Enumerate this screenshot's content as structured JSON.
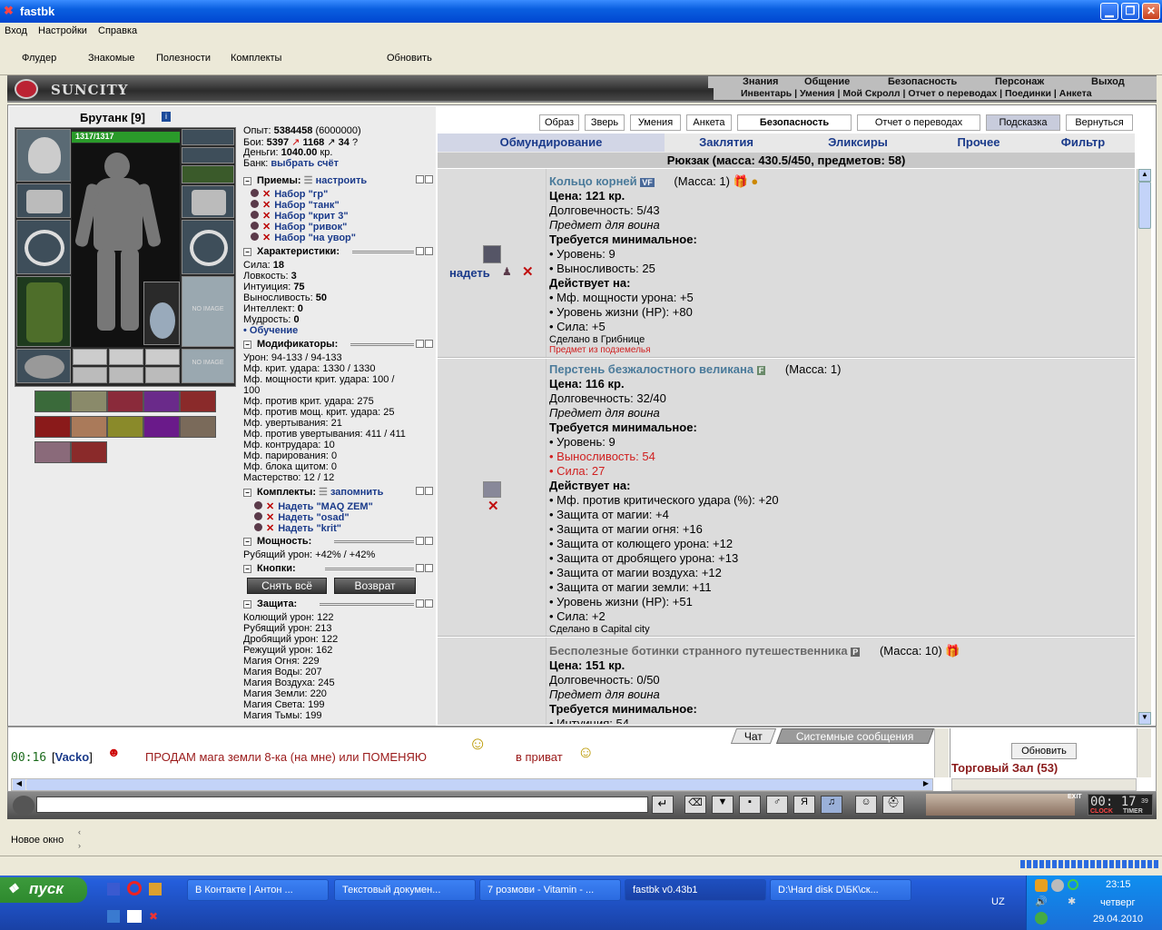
{
  "window": {
    "title": "fastbk",
    "btn_min": "▁",
    "btn_max": "❐",
    "btn_close": "✕"
  },
  "menu": [
    "Вход",
    "Настройки",
    "Справка"
  ],
  "toolbar": [
    "Флудер",
    "Знакомые",
    "Полезности",
    "Комплекты",
    "Обновить"
  ],
  "logo": "SUNCITY",
  "topnav1": [
    "Знания",
    "Общение",
    "Безопасность",
    "Персонаж",
    "Выход"
  ],
  "topnav2": "Инвентарь | Умения | Мой Скролл | Отчет о переводах | Поединки | Анкета",
  "character": {
    "name": "Брутанк [9]",
    "hp": "1317/1317",
    "empty_slot": "NO IMAGE"
  },
  "stats": {
    "exp_label": "Опыт:",
    "exp_value": "5384458",
    "exp_next": "(6000000)",
    "fights_label": "Бои:",
    "fights_win": "5397",
    "fights_lose": "1168",
    "fights_draw": "34",
    "money_label": "Деньги:",
    "money_value": "1040.00",
    "money_unit": "кр.",
    "bank_label": "Банк:",
    "bank_link": "выбрать счёт"
  },
  "priemy": {
    "title": "Приемы:",
    "link": "настроить",
    "sets": [
      "Набор \"гр\"",
      "Набор \"танк\"",
      "Набор \"крит 3\"",
      "Набор \"ривок\"",
      "Набор \"на увор\""
    ]
  },
  "chars": {
    "title": "Характеристики:",
    "rows": [
      [
        "Сила:",
        "18"
      ],
      [
        "Ловкость:",
        "3"
      ],
      [
        "Интуиция:",
        "75"
      ],
      [
        "Выносливость:",
        "50"
      ],
      [
        "Интеллект:",
        "0"
      ],
      [
        "Мудрость:",
        "0"
      ]
    ],
    "learn": "• Обучение"
  },
  "mods": {
    "title": "Модификаторы:",
    "rows": [
      "Урон: 94-133 / 94-133",
      "Мф. крит. удара: 1330 / 1330",
      "Мф. мощности крит. удара: 100 /",
      "100",
      "Мф. против крит. удара: 275",
      "Мф. против мощ. крит. удара: 25",
      "Мф. увертывания: 21",
      "Мф. против увертывания: 411 / 411",
      "Мф. контрудара: 10",
      "Мф. парирования: 0",
      "Мф. блока щитом: 0",
      "Мастерство: 12 / 12"
    ]
  },
  "komplekty": {
    "title": "Комплекты:",
    "link": "запомнить",
    "sets": [
      "Надеть \"MAQ ZEM\"",
      "Надеть \"osad\"",
      "Надеть \"krit\""
    ]
  },
  "moshnosti": {
    "title": "Мощность:",
    "row": "Рубящий урон: +42% / +42%"
  },
  "knopki": {
    "title": "Кнопки:",
    "btn1": "Снять всё",
    "btn2": "Возврат"
  },
  "zashita": {
    "title": "Защита:",
    "rows": [
      "Колющий урон: 122",
      "Рубящий урон: 213",
      "Дробящий урон: 122",
      "Режущий урон: 162",
      "Магия Огня: 229",
      "Магия Воды: 207",
      "Магия Воздуха: 245",
      "Магия Земли: 220",
      "Магия Света: 199",
      "Магия Тьмы: 199"
    ]
  },
  "tabs": [
    "Образ",
    "Зверь",
    "Умения",
    "Анкета",
    "Безопасность",
    "Отчет о переводах",
    "Подсказка",
    "Вернуться"
  ],
  "categories": [
    "Обмундирование",
    "Заклятия",
    "Эликсиры",
    "Прочее",
    "Фильтр"
  ],
  "backpack": "Рюкзак (масса: 430.5/450, предметов: 58)",
  "items": [
    {
      "name": "Кольцо корней",
      "badge": "VF",
      "mass": "(Масса: 1)",
      "price": "Цена: 121 кр.",
      "dur": "Долговечность: 5/43",
      "cls": "Предмет для воина",
      "req_title": "Требуется минимальное:",
      "req": [
        "• Уровень: 9",
        "• Выносливость: 25"
      ],
      "eff_title": "Действует на:",
      "eff": [
        "• Мф. мощности урона: +5",
        "• Уровень жизни (HP): +80",
        "• Сила: +5"
      ],
      "made": "Сделано в Грибнице",
      "note": "Предмет из подземелья",
      "action": "надеть"
    },
    {
      "name": "Перстень безжалостного великана",
      "badge": "F",
      "mass": "(Масса: 1)",
      "price": "Цена: 116 кр.",
      "dur": "Долговечность: 32/40",
      "cls": "Предмет для воина",
      "req_title": "Требуется минимальное:",
      "req": [
        "• Уровень: 9",
        "• Выносливость: 54",
        "• Сила: 27"
      ],
      "eff_title": "Действует на:",
      "eff": [
        "• Мф. против критического удара (%): +20",
        "• Защита от магии: +4",
        "• Защита от магии огня: +16",
        "• Защита от колющего урона: +12",
        "• Защита от дробящего урона: +13",
        "• Защита от магии воздуха: +12",
        "• Защита от магии земли: +11",
        "• Уровень жизни (HP): +51",
        "• Сила: +2"
      ],
      "made": "Сделано в Capital city"
    },
    {
      "name": "Бесполезные ботинки странного путешественника",
      "badge": "P",
      "mass": "(Масса: 10)",
      "price": "Цена: 151 кр.",
      "dur": "Долговечность: 0/50",
      "cls": "Предмет для воина",
      "req_title": "Требуется минимальное:",
      "req_partial": "• Интуиция: 54"
    }
  ],
  "chat": {
    "tab1": "Чат",
    "tab2": "Системные сообщения",
    "time": "00:16",
    "nick": "Vacko",
    "msg": "ПРОДАМ мага земли 8-ка (на мне) или ПОМЕНЯЮ",
    "msg2": "в приват",
    "refresh": "Обновить",
    "room": "Торговый Зал (53)"
  },
  "clock": {
    "time": "00: 17",
    "sec": "39",
    "clock_label": "CLOCK",
    "timer_label": "TIMER",
    "exit": "EXIT"
  },
  "status": {
    "newwin": "Новое окно"
  },
  "taskbar": {
    "start": "пуск",
    "tasks": [
      "В Контакте | Антон ...",
      "Текстовый докумен...",
      "7 розмови - Vitamin - ...",
      "fastbk v0.43b1",
      "D:\\Hard disk D\\БК\\ск..."
    ],
    "lang": "UZ",
    "time": "23:15",
    "day": "четверг",
    "date": "29.04.2010"
  }
}
